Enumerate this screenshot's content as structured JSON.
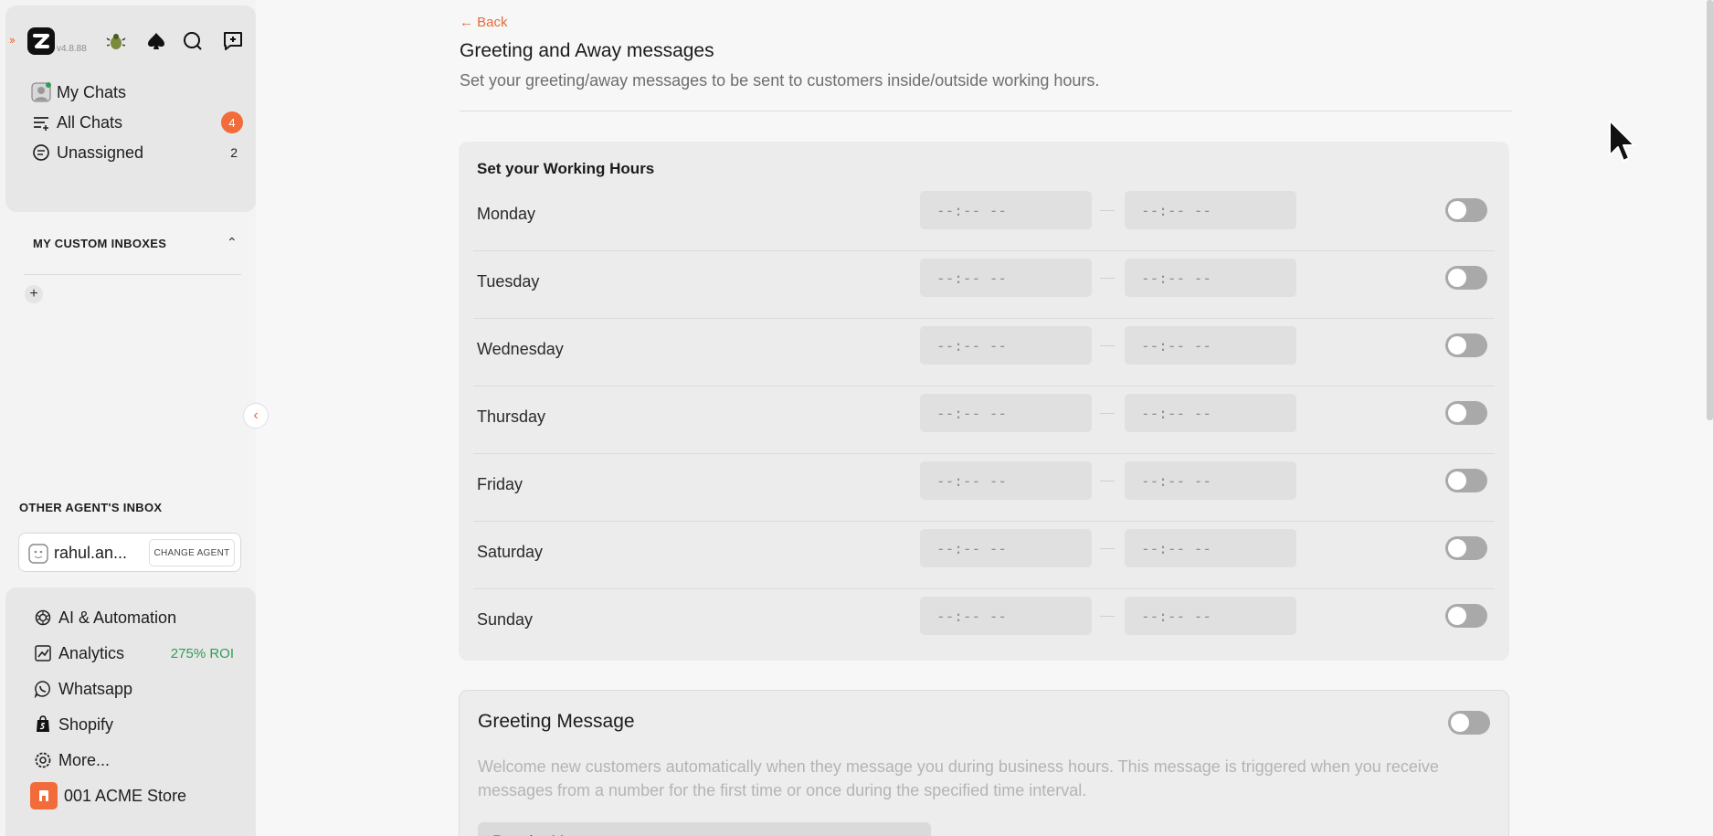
{
  "app": {
    "version": "v4.8.88"
  },
  "sidebar": {
    "primary": [
      {
        "label": "My Chats",
        "icon": "user-avatar-icon"
      },
      {
        "label": "All Chats",
        "icon": "filter-list-icon",
        "badge": "4"
      },
      {
        "label": "Unassigned",
        "icon": "chat-bubble-icon",
        "count": "2"
      }
    ],
    "custom_inboxes_title": "MY CUSTOM INBOXES",
    "other_agent_title": "OTHER AGENT'S INBOX",
    "agent_name": "rahul.an...",
    "change_agent_label": "CHANGE AGENT",
    "bottom": [
      {
        "label": "AI & Automation",
        "icon": "openai-icon"
      },
      {
        "label": "Analytics",
        "icon": "chart-icon",
        "extra": "275% ROI"
      },
      {
        "label": "Whatsapp",
        "icon": "whatsapp-icon"
      },
      {
        "label": "Shopify",
        "icon": "shopify-icon"
      },
      {
        "label": "More...",
        "icon": "gear-icon"
      }
    ],
    "store_name": "001 ACME Store"
  },
  "main": {
    "back_label": "← Back",
    "title": "Greeting and Away messages",
    "subtitle": "Set your greeting/away messages to be sent to customers inside/outside working hours.",
    "working_hours": {
      "title": "Set your Working Hours",
      "days": [
        {
          "day": "Monday",
          "start": "--:-- --",
          "end": "--:-- --",
          "enabled": false
        },
        {
          "day": "Tuesday",
          "start": "--:-- --",
          "end": "--:-- --",
          "enabled": false
        },
        {
          "day": "Wednesday",
          "start": "--:-- --",
          "end": "--:-- --",
          "enabled": false
        },
        {
          "day": "Thursday",
          "start": "--:-- --",
          "end": "--:-- --",
          "enabled": false
        },
        {
          "day": "Friday",
          "start": "--:-- --",
          "end": "--:-- --",
          "enabled": false
        },
        {
          "day": "Saturday",
          "start": "--:-- --",
          "end": "--:-- --",
          "enabled": false
        },
        {
          "day": "Sunday",
          "start": "--:-- --",
          "end": "--:-- --",
          "enabled": false
        }
      ]
    },
    "greeting": {
      "title": "Greeting Message",
      "enabled": false,
      "description": "Welcome new customers automatically when they message you during business hours. This message is triggered when you receive messages from a number for the first time or once during the specified time interval.",
      "message_type": "Regular Message"
    }
  },
  "colors": {
    "accent": "#f26b3a",
    "roi": "#2f9e55"
  }
}
